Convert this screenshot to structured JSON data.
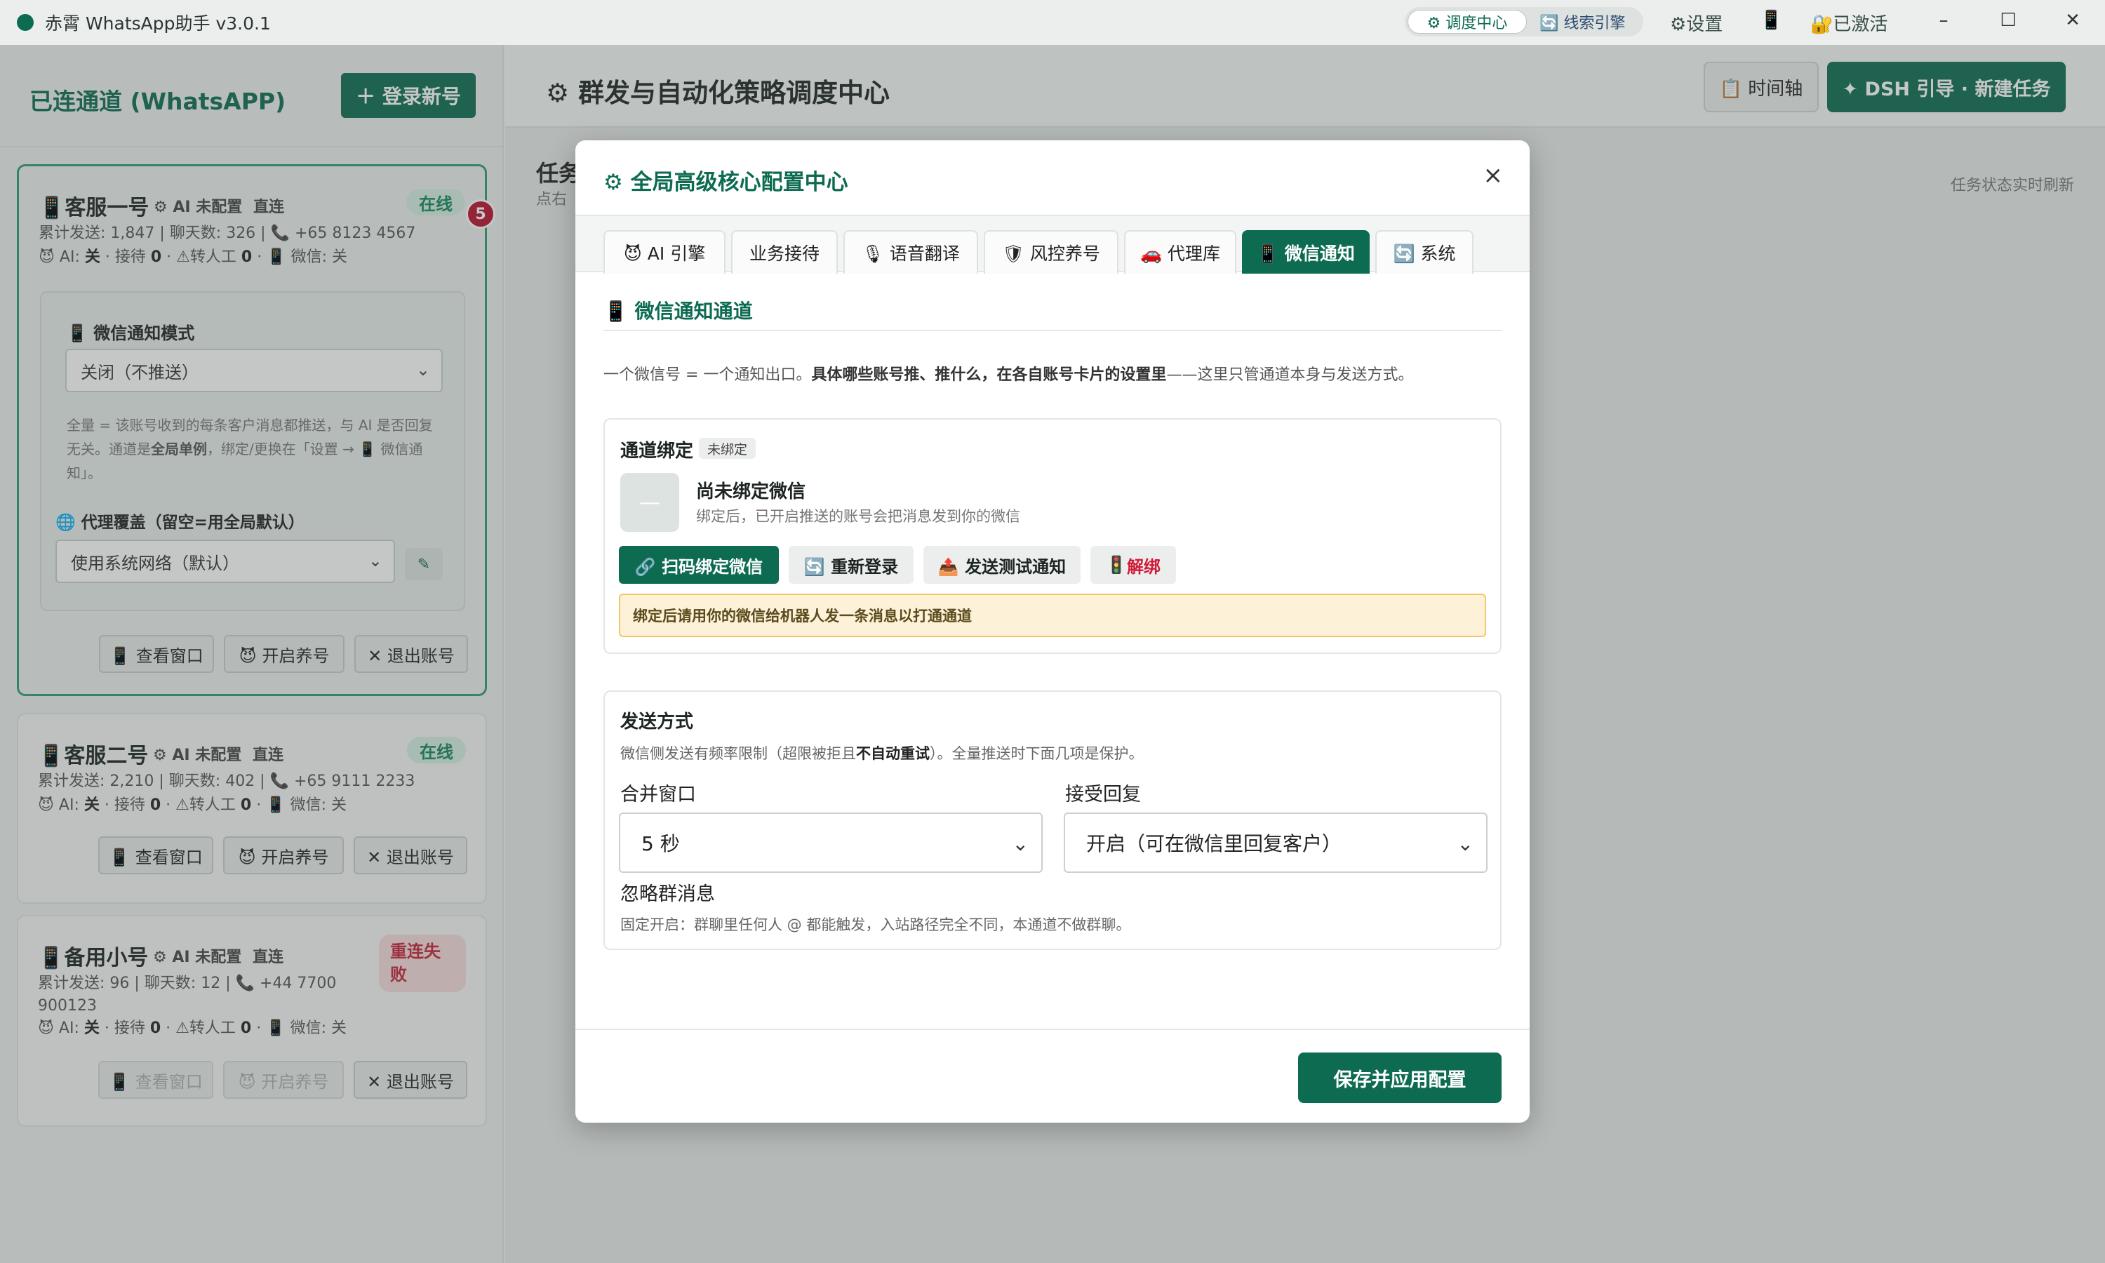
{
  "titlebar": {
    "app_title": "赤霄 WhatsApp助手 v3.0.1",
    "seg_dispatch": "⚙ 调度中心",
    "seg_leads": "🔄 线索引擎",
    "settings": "⚙设置",
    "phone_icon": "📱",
    "activated": "🔐已激活",
    "minimize": "–",
    "maximize": "☐",
    "close": "✕"
  },
  "sidebar": {
    "title": "已连通道 (WhatsAPP)",
    "login_button": "＋ 登录新号",
    "unread_count": "5",
    "cards": [
      {
        "name": "📱客服一号",
        "ai_status": "⚙ AI 未配置",
        "route": "直连",
        "status": "在线",
        "stats_line": "累计发送: 1,847 | 聊天数: 326 | 📞 +65 8123 4567",
        "ai_line_prefix": "😈 AI: ",
        "ai_value": "关",
        "reception_label": " · 接待 ",
        "reception_value": "0",
        "transfer_label": " · ⚠转人工 ",
        "transfer_value": "0",
        "wechat_label": " · 📱 微信: 关",
        "wechat_mode_label": "📱 微信通知模式",
        "wechat_mode_value": "关闭（不推送）",
        "help_part1": "全量 = 该账号收到的每条客户消息都推送，与 AI 是否回复无关。通道是",
        "help_bold": "全局单例",
        "help_part2": "，绑定/更换在「设置 → 📱 微信通知」。",
        "proxy_label": "🌐 代理覆盖（留空=用全局默认）",
        "proxy_value": "使用系统网络（默认）",
        "btn_view": "📱 查看窗口",
        "btn_nurture": "😈 开启养号",
        "btn_logout": "✕ 退出账号"
      },
      {
        "name": "📱客服二号",
        "ai_status": "⚙ AI 未配置",
        "route": "直连",
        "status": "在线",
        "stats_line": "累计发送: 2,210 | 聊天数: 402 | 📞 +65 9111 2233",
        "ai_line_prefix": "😈 AI: ",
        "ai_value": "关",
        "reception_label": " · 接待 ",
        "reception_value": "0",
        "transfer_label": " · ⚠转人工 ",
        "transfer_value": "0",
        "wechat_label": " · 📱 微信: 关",
        "btn_view": "📱 查看窗口",
        "btn_nurture": "😈 开启养号",
        "btn_logout": "✕ 退出账号"
      },
      {
        "name": "📱备用小号",
        "ai_status": "⚙ AI 未配置",
        "route": "直连",
        "status": "重连失败",
        "stats_line1": "累计发送: 96 | 聊天数: 12 | 📞 +44 7700",
        "stats_line2": "900123",
        "ai_line_prefix": "😈 AI: ",
        "ai_value": "关",
        "reception_label": " · 接待 ",
        "reception_value": "0",
        "transfer_label": " · ⚠转人工 ",
        "transfer_value": "0",
        "wechat_label": " · 📱 微信: 关",
        "btn_view": "📱 查看窗口",
        "btn_nurture": "😈 开启养号",
        "btn_logout": "✕ 退出账号"
      }
    ]
  },
  "main": {
    "title": "⚙ 群发与自动化策略调度中心",
    "btn_timeline": "📋 时间轴",
    "btn_new_task": "✦ DSH 引导 · 新建任务",
    "task_title": "任务",
    "task_sub": "点右",
    "task_right": "任务状态实时刷新"
  },
  "modal": {
    "title": "⚙ 全局高级核心配置中心",
    "close": "×",
    "tabs": [
      "😈 AI 引擎",
      "业务接待",
      "🎙 语音翻译",
      "🛡 风控养号",
      "🚗 代理库",
      "📱 微信通知",
      "🔄 系统"
    ],
    "section_title": "📱 微信通知通道",
    "desc_part1": "一个微信号 = 一个通知出口。",
    "desc_bold": "具体哪些账号推、推什么，在各自账号卡片的设置里",
    "desc_part2": "——这里只管通道本身与发送方式。",
    "binding": {
      "title": "通道绑定",
      "tag": "未绑定",
      "avatar_placeholder": "—",
      "name": "尚未绑定微信",
      "sub": "绑定后，已开启推送的账号会把消息发到你的微信",
      "btn_scan": "🔗 扫码绑定微信",
      "btn_relogin": "🔄 重新登录",
      "btn_test": "📤 发送测试通知",
      "btn_unbind_icon": "🚦",
      "btn_unbind": "解绑",
      "warning": "绑定后请用你的微信给机器人发一条消息以打通通道"
    },
    "send": {
      "title": "发送方式",
      "desc_part1": "微信侧发送有频率限制（超限被拒且",
      "desc_bold": "不自动重试",
      "desc_part2": "）。全量推送时下面几项是保护。",
      "merge_label": "合并窗口",
      "merge_value": "5 秒",
      "reply_label": "接受回复",
      "reply_value": "开启（可在微信里回复客户）",
      "ignore_label": "忽略群消息",
      "ignore_desc": "固定开启：群聊里任何人 @ 都能触发，入站路径完全不同，本通道不做群聊。"
    },
    "save_button": "保存并应用配置"
  }
}
